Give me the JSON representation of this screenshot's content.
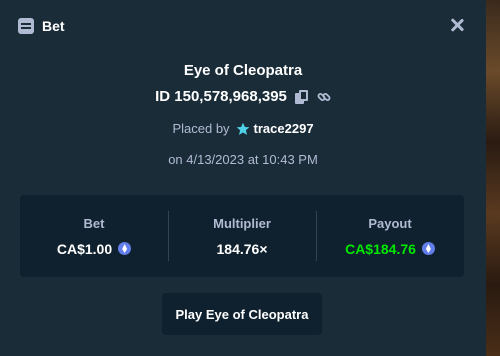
{
  "header": {
    "title": "Bet"
  },
  "game": {
    "name": "Eye of Cleopatra"
  },
  "bet": {
    "id_text": "ID 150,578,968,395"
  },
  "placed": {
    "prefix": "Placed by",
    "username": "trace2297"
  },
  "date_text": "on 4/13/2023 at 10:43 PM",
  "stats": {
    "bet_label": "Bet",
    "bet_value": "CA$1.00",
    "multiplier_label": "Multiplier",
    "multiplier_value": "184.76×",
    "payout_label": "Payout",
    "payout_value": "CA$184.76"
  },
  "play_button": "Play Eye of Cleopatra",
  "icons": {
    "header": "bet-slip-icon",
    "close": "close-icon",
    "copy": "copy-icon",
    "link": "link-icon",
    "vip": "star-icon",
    "currency": "ethereum-coin-icon"
  },
  "colors": {
    "background": "#1a2c38",
    "panel": "#0f212e",
    "muted_text": "#b1bad3",
    "payout_green": "#00e701",
    "coin_blue": "#627eea",
    "star_cyan": "#4fd1e8"
  }
}
